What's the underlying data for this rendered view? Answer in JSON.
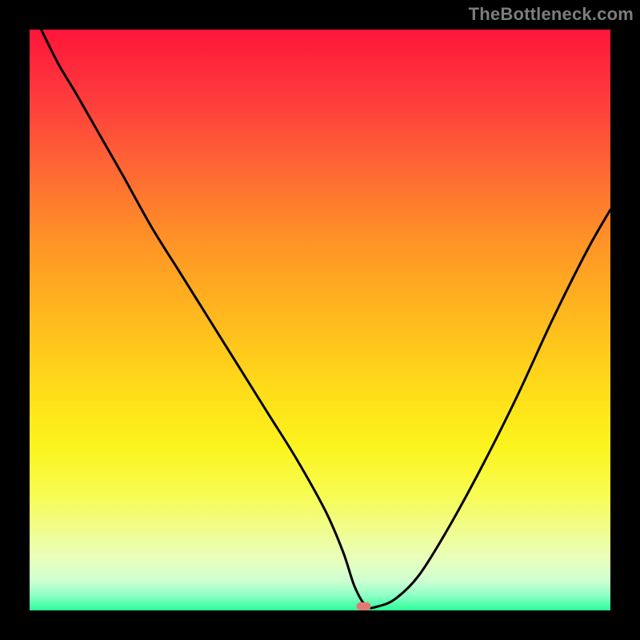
{
  "watermark": "TheBottleneck.com",
  "chart_data": {
    "type": "line",
    "title": "",
    "xlabel": "",
    "ylabel": "",
    "xlim": [
      0,
      100
    ],
    "ylim": [
      0,
      100
    ],
    "legend": false,
    "grid": false,
    "gradient_note": "vertical red→yellow→green gradient (green at bottom)",
    "marker_points": [
      {
        "x": 57.5,
        "y": 0.7,
        "color": "#e67873",
        "shape": "rounded-rect"
      }
    ],
    "series": [
      {
        "name": "bottleneck-curve",
        "color": "#000000",
        "linewidth": 3,
        "x": [
          2,
          5,
          8,
          12,
          16,
          21,
          26,
          31,
          36,
          41,
          46,
          51,
          54,
          56,
          58,
          60,
          63,
          67,
          72,
          78,
          84,
          90,
          96,
          100
        ],
        "y": [
          100,
          94,
          89,
          82,
          75,
          66,
          58,
          50,
          42,
          34,
          26,
          17,
          10,
          4,
          0.7,
          0.7,
          2,
          6,
          14,
          25,
          37,
          50,
          62,
          69
        ]
      }
    ]
  }
}
